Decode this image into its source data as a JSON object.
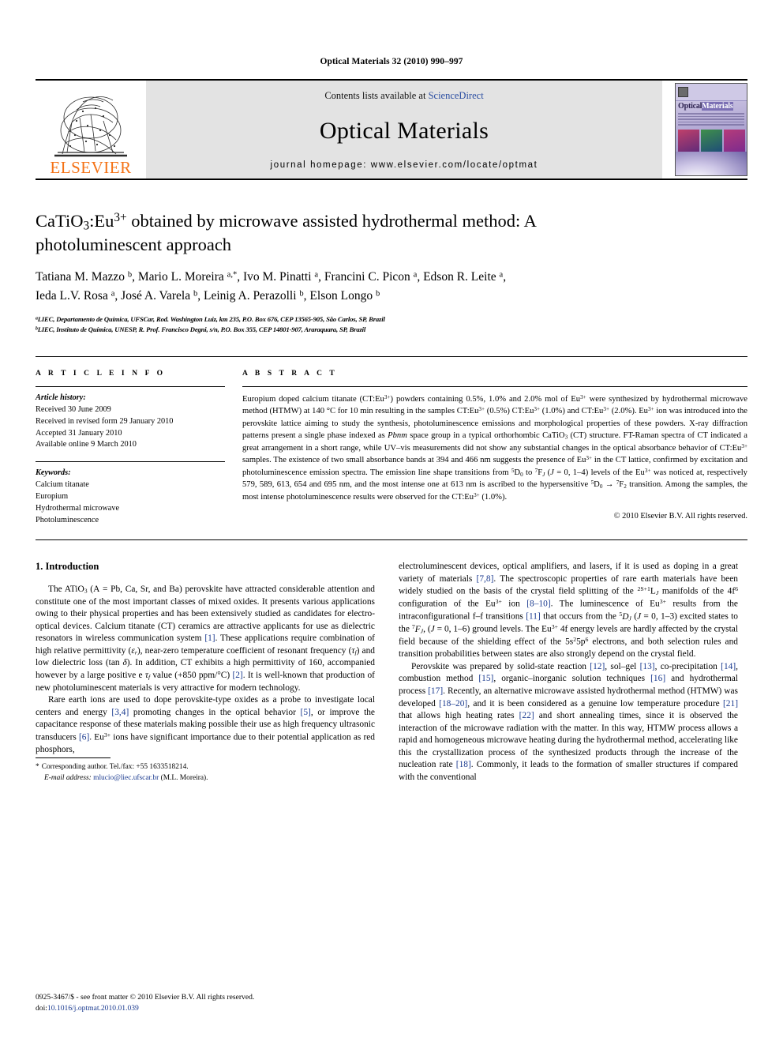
{
  "running_head": "Optical Materials 32 (2010) 990–997",
  "banner": {
    "publisher_name": "ELSEVIER",
    "contents_prefix": "Contents lists available at ",
    "contents_link": "ScienceDirect",
    "journal_name": "Optical Materials",
    "homepage": "journal homepage: www.elsevier.com/locate/optmat",
    "cover_title_a": "Optical",
    "cover_title_b": "Materials"
  },
  "article": {
    "title_line1_a": "CaTiO",
    "title_line1_sub": "3",
    "title_line1_b": ":Eu",
    "title_line1_sup": "3+",
    "title_line1_c": " obtained by microwave assisted hydrothermal method: A",
    "title_line2": "photoluminescent approach",
    "authors": "Tatiana M. Mazzo b, Mario L. Moreira a,*, Ivo M. Pinatti a, Francini C. Picon a, Edson R. Leite a, Ieda L.V. Rosa a, José A. Varela b, Leinig A. Perazolli b, Elson Longo b",
    "affiliation_a": "LIEC, Departamento de Química, UFSCar, Rod. Washington Luiz, km 235, P.O. Box 676, CEP 13565-905, São Carlos, SP, Brazil",
    "affiliation_b": "LIEC, Instituto de Química, UNESP, R. Prof. Francisco Degni, s/n, P.O. Box 355, CEP 14801-907, Araraquara, SP, Brazil"
  },
  "article_info": {
    "heading": "A R T I C L E   I N F O",
    "history_label": "Article history:",
    "history": [
      "Received 30 June 2009",
      "Received in revised form 29 January 2010",
      "Accepted 31 January 2010",
      "Available online 9 March 2010"
    ],
    "keywords_label": "Keywords:",
    "keywords": [
      "Calcium titanate",
      "Europium",
      "Hydrothermal microwave",
      "Photoluminescence"
    ]
  },
  "abstract": {
    "heading": "A B S T R A C T",
    "copyright": "© 2010 Elsevier B.V. All rights reserved."
  },
  "introduction": {
    "heading": "1. Introduction"
  },
  "footnote": {
    "corresponding": "Corresponding author. Tel./fax: +55 1633518214.",
    "email_label": "E-mail address:",
    "email": "mlucio@liec.ufscar.br",
    "email_owner": "(M.L. Moreira)."
  },
  "imprint": {
    "issn_line": "0925-3467/$ - see front matter © 2010 Elsevier B.V. All rights reserved.",
    "doi_label": "doi:",
    "doi": "10.1016/j.optmat.2010.01.039"
  },
  "colors": {
    "link": "#1a3a8f",
    "sciencedirect": "#2b4ea2",
    "elsevier_orange": "#F47216",
    "banner_gray": "#e3e3e3"
  }
}
